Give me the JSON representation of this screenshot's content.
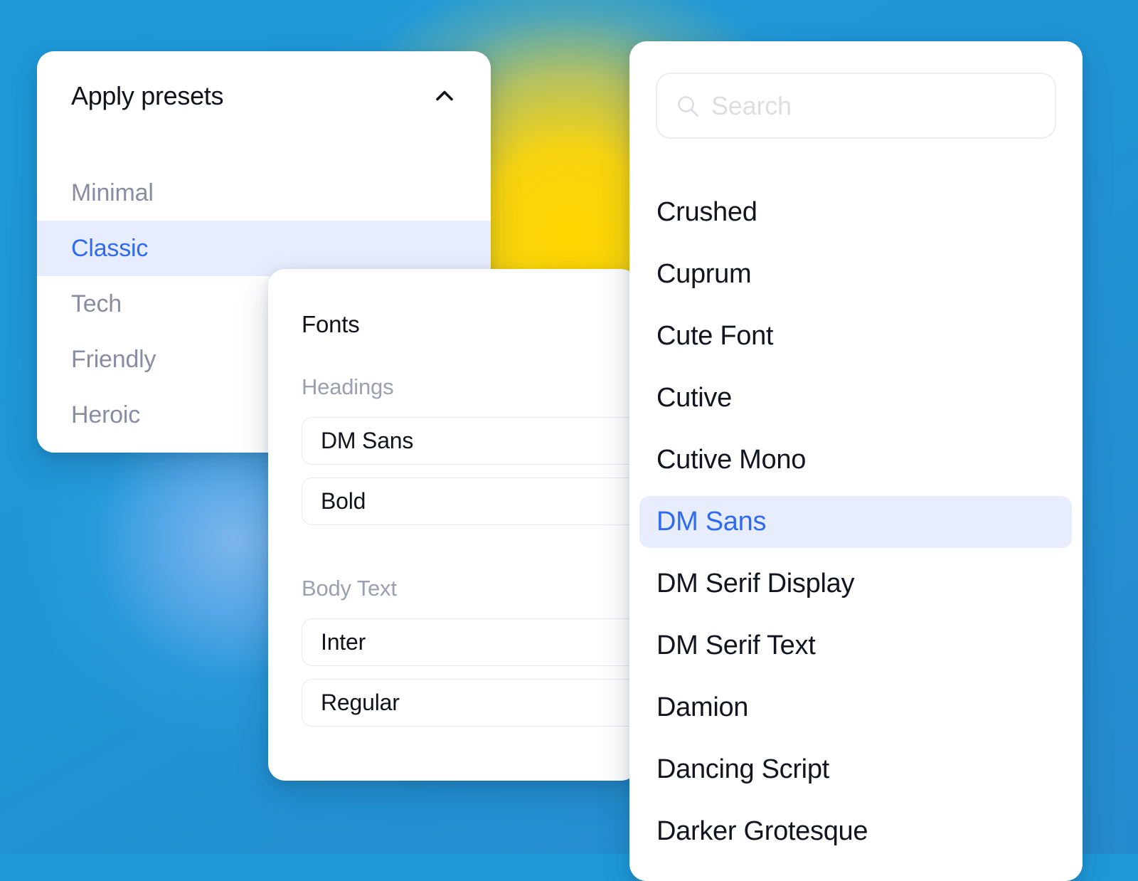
{
  "background": {
    "base_color": "#1E9AD9",
    "accent_color": "#FFD600",
    "glow_color": "#87B9F0"
  },
  "theme": {
    "accent_blue": "#2E6BF0",
    "highlight_bg": "#E7EDFC",
    "muted_text": "#898DA4",
    "body_text": "#10131C",
    "placeholder_text": "#DCDEE4",
    "border": "#E8E9EE"
  },
  "presets_panel": {
    "title": "Apply presets",
    "collapse_icon": "chevron-up-icon",
    "items": [
      {
        "label": "Minimal",
        "selected": false
      },
      {
        "label": "Classic",
        "selected": true
      },
      {
        "label": "Tech",
        "selected": false
      },
      {
        "label": "Friendly",
        "selected": false
      },
      {
        "label": "Heroic",
        "selected": false
      }
    ]
  },
  "fonts_panel": {
    "title": "Fonts",
    "groups": [
      {
        "label": "Headings",
        "family": "DM Sans",
        "weight": "Bold"
      },
      {
        "label": "Body Text",
        "family": "Inter",
        "weight": "Regular"
      }
    ]
  },
  "font_list_panel": {
    "search": {
      "placeholder": "Search",
      "value": "",
      "icon": "search-icon"
    },
    "items": [
      {
        "label": "Crushed",
        "selected": false
      },
      {
        "label": "Cuprum",
        "selected": false
      },
      {
        "label": "Cute Font",
        "selected": false
      },
      {
        "label": "Cutive",
        "selected": false
      },
      {
        "label": "Cutive Mono",
        "selected": false
      },
      {
        "label": "DM Sans",
        "selected": true
      },
      {
        "label": "DM Serif Display",
        "selected": false
      },
      {
        "label": "DM Serif Text",
        "selected": false
      },
      {
        "label": "Damion",
        "selected": false
      },
      {
        "label": "Dancing Script",
        "selected": false
      },
      {
        "label": "Darker Grotesque",
        "selected": false
      }
    ]
  }
}
